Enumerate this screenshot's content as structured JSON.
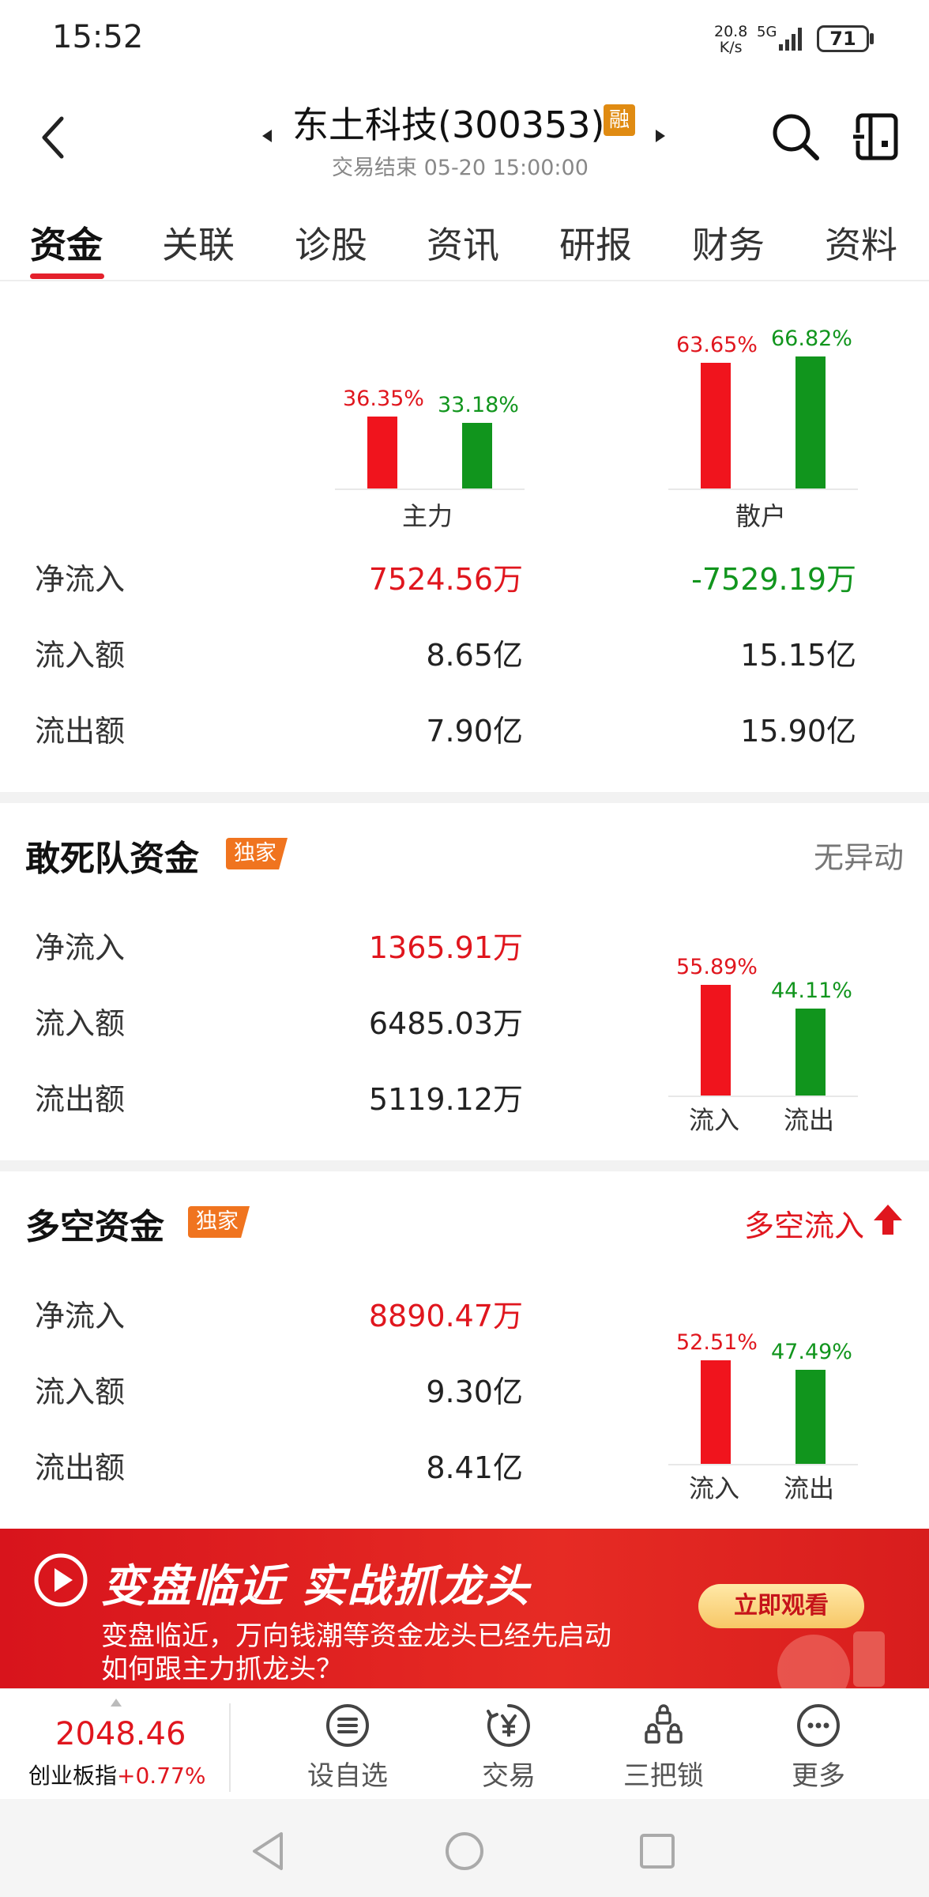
{
  "status_bar": {
    "time": "15:52",
    "net_speed_value": "20.8",
    "net_speed_unit": "K/s",
    "network": "5G",
    "battery": "71"
  },
  "header": {
    "title": "东土科技(300353)",
    "margin_badge": "融",
    "trade_status": "交易结束 05-20 15:00:00"
  },
  "tabs": [
    {
      "label": "资金",
      "active": true
    },
    {
      "label": "关联"
    },
    {
      "label": "诊股"
    },
    {
      "label": "资讯"
    },
    {
      "label": "研报"
    },
    {
      "label": "财务"
    },
    {
      "label": "资料"
    }
  ],
  "fund_flow": {
    "chart_data": [
      {
        "type": "bar",
        "categories": [
          "主力"
        ],
        "series": [
          {
            "values": [
              36.35
            ],
            "color": "#f0141d"
          },
          {
            "values": [
              33.18
            ],
            "color": "#11951d"
          }
        ],
        "labels": [
          "36.35%",
          "33.18%"
        ]
      },
      {
        "type": "bar",
        "categories": [
          "散户"
        ],
        "series": [
          {
            "values": [
              63.65
            ],
            "color": "#f0141d"
          },
          {
            "values": [
              66.82
            ],
            "color": "#11951d"
          }
        ],
        "labels": [
          "63.65%",
          "66.82%"
        ]
      }
    ],
    "rows": [
      {
        "label": "净流入",
        "main": "7524.56万",
        "retail": "-7529.19万"
      },
      {
        "label": "流入额",
        "main": "8.65亿",
        "retail": "15.15亿"
      },
      {
        "label": "流出额",
        "main": "7.90亿",
        "retail": "15.90亿"
      }
    ]
  },
  "dare_team": {
    "title": "敢死队资金",
    "badge": "独家",
    "status": "无异动",
    "rows": [
      {
        "label": "净流入",
        "value": "1365.91万"
      },
      {
        "label": "流入额",
        "value": "6485.03万"
      },
      {
        "label": "流出额",
        "value": "5119.12万"
      }
    ],
    "chart_data": {
      "type": "bar",
      "categories": [
        "流入",
        "流出"
      ],
      "values": [
        55.89,
        44.11
      ],
      "labels": [
        "55.89%",
        "44.11%"
      ],
      "colors": [
        "#f0141d",
        "#11951d"
      ]
    }
  },
  "long_short": {
    "title": "多空资金",
    "badge": "独家",
    "status": "多空流入",
    "rows": [
      {
        "label": "净流入",
        "value": "8890.47万"
      },
      {
        "label": "流入额",
        "value": "9.30亿"
      },
      {
        "label": "流出额",
        "value": "8.41亿"
      }
    ],
    "chart_data": {
      "type": "bar",
      "categories": [
        "流入",
        "流出"
      ],
      "values": [
        52.51,
        47.49
      ],
      "labels": [
        "52.51%",
        "47.49%"
      ],
      "colors": [
        "#f0141d",
        "#11951d"
      ]
    }
  },
  "banner": {
    "title": "变盘临近 实战抓龙头",
    "subtitle_1": "变盘临近，万向钱潮等资金龙头已经先启动",
    "subtitle_2": "如何跟主力抓龙头？",
    "cta": "立即观看"
  },
  "bottom_bar": {
    "index_value": "2048.46",
    "index_name": "创业板指",
    "index_change": "+0.77%",
    "items": [
      {
        "label": "设自选",
        "icon": "list-icon"
      },
      {
        "label": "交易",
        "icon": "yuan-icon"
      },
      {
        "label": "三把锁",
        "icon": "lock-icon"
      },
      {
        "label": "更多",
        "icon": "more-icon"
      }
    ]
  }
}
